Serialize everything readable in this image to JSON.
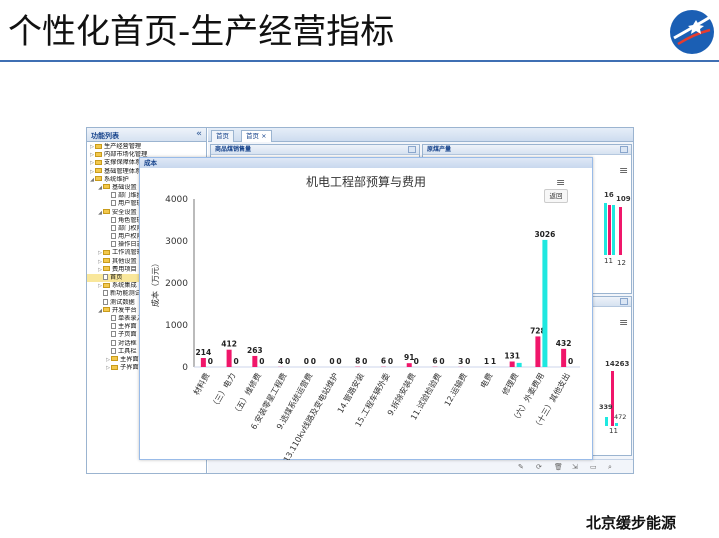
{
  "slide": {
    "title": "个性化首页-生产经营指标",
    "company": "北京缓步能源"
  },
  "left_panel": {
    "header": "功能列表",
    "collapse_icon": "«",
    "items": [
      {
        "label": "生产经营管理",
        "level": 0,
        "type": "folder",
        "twist": "▷"
      },
      {
        "label": "内部市场化管理",
        "level": 0,
        "type": "folder",
        "twist": "▷"
      },
      {
        "label": "支撑保障体系",
        "level": 0,
        "type": "folder",
        "twist": "▷"
      },
      {
        "label": "基础管理体系",
        "level": 0,
        "type": "folder",
        "twist": "▷"
      },
      {
        "label": "系统维护",
        "level": 0,
        "type": "folder",
        "twist": "◢"
      },
      {
        "label": "基础设置",
        "level": 1,
        "type": "folder",
        "twist": "◢"
      },
      {
        "label": "部门维护",
        "level": 2,
        "type": "page",
        "twist": ""
      },
      {
        "label": "用户管理",
        "level": 2,
        "type": "page",
        "twist": ""
      },
      {
        "label": "安全设置",
        "level": 1,
        "type": "folder",
        "twist": "◢"
      },
      {
        "label": "角色管理",
        "level": 2,
        "type": "page",
        "twist": ""
      },
      {
        "label": "部门权限",
        "level": 2,
        "type": "page",
        "twist": ""
      },
      {
        "label": "用户权限",
        "level": 2,
        "type": "page",
        "twist": ""
      },
      {
        "label": "操作日志",
        "level": 2,
        "type": "page",
        "twist": ""
      },
      {
        "label": "工作流管理",
        "level": 1,
        "type": "folder",
        "twist": "▷"
      },
      {
        "label": "其他设置",
        "level": 1,
        "type": "folder",
        "twist": "▷"
      },
      {
        "label": "费用项目",
        "level": 1,
        "type": "folder",
        "twist": "▷"
      },
      {
        "label": "首页",
        "level": 1,
        "type": "page",
        "twist": "",
        "selected": true
      },
      {
        "label": "系统集成",
        "level": 1,
        "type": "folder",
        "twist": "▷"
      },
      {
        "label": "新功能测试",
        "level": 1,
        "type": "page",
        "twist": ""
      },
      {
        "label": "测试数据",
        "level": 1,
        "type": "page",
        "twist": ""
      },
      {
        "label": "开发平台",
        "level": 1,
        "type": "folder",
        "twist": "◢"
      },
      {
        "label": "单表录入",
        "level": 2,
        "type": "page",
        "twist": ""
      },
      {
        "label": "主界面",
        "level": 2,
        "type": "page",
        "twist": ""
      },
      {
        "label": "子页面",
        "level": 2,
        "type": "page",
        "twist": ""
      },
      {
        "label": "对话框",
        "level": 2,
        "type": "page",
        "twist": ""
      },
      {
        "label": "工具栏",
        "level": 2,
        "type": "page",
        "twist": ""
      },
      {
        "label": "主界面",
        "level": 2,
        "type": "folder",
        "twist": "▷"
      },
      {
        "label": "子界面",
        "level": 2,
        "type": "folder",
        "twist": "▷"
      }
    ]
  },
  "tabs": [
    {
      "label": "首页"
    },
    {
      "label": "首页 ×"
    }
  ],
  "panes": {
    "sales_title": "商品煤销售量",
    "production_title": "原煤产量"
  },
  "background_chart_labels": {
    "top_values": [
      "16",
      "109"
    ],
    "top_ticks": [
      "11",
      "12"
    ],
    "bottom_values": [
      "14263",
      "339",
      "472"
    ],
    "bottom_ticks": [
      "11"
    ]
  },
  "popup": {
    "header": "成本",
    "back_button": "返回",
    "menu_icon": "≡"
  },
  "colors": {
    "series_pink": "#f0166a",
    "series_cyan": "#1fe8e0",
    "title_rule": "#3f6fb3",
    "panel_header": "#15428b"
  },
  "chart_data": {
    "type": "bar",
    "title": "机电工程部预算与费用",
    "xlabel": "",
    "ylabel": "成本（万元）",
    "ylim": [
      0,
      4000
    ],
    "yticks": [
      0,
      1000,
      2000,
      3000,
      4000
    ],
    "categories": [
      "材料费",
      "（三）电力",
      "（五）维修费",
      "6.安装零星工程费",
      "9.选煤系统运营费",
      "13.110kv线路及变电站维护",
      "14.管路安装",
      "15.工程车辆外委",
      "9.拆除安装费",
      "11.试验检验费",
      "12.运输费",
      "电费",
      "修理费",
      "（六）外委费用",
      "（十三）其他支出"
    ],
    "series": [
      {
        "values": [
          214,
          412,
          263,
          4,
          0,
          0,
          8,
          6,
          91,
          6,
          3,
          1,
          131,
          728,
          432
        ],
        "labels": [
          "214",
          "412",
          "263",
          "4",
          "0",
          "0",
          "8",
          "6",
          "91",
          "6",
          "3",
          "1",
          "131",
          "728",
          "432"
        ],
        "color": "#f0166a"
      },
      {
        "values": [
          0,
          0,
          0,
          0,
          0,
          0,
          0,
          0,
          0,
          0,
          0,
          1,
          98,
          3026,
          0
        ],
        "labels": [
          "0",
          "0",
          "0",
          "0",
          "0",
          "0",
          "0",
          "0",
          "0",
          "0",
          "0",
          "1",
          "",
          "3026",
          "0"
        ],
        "color": "#1fe8e0"
      }
    ],
    "grid": false,
    "legend": "none"
  }
}
